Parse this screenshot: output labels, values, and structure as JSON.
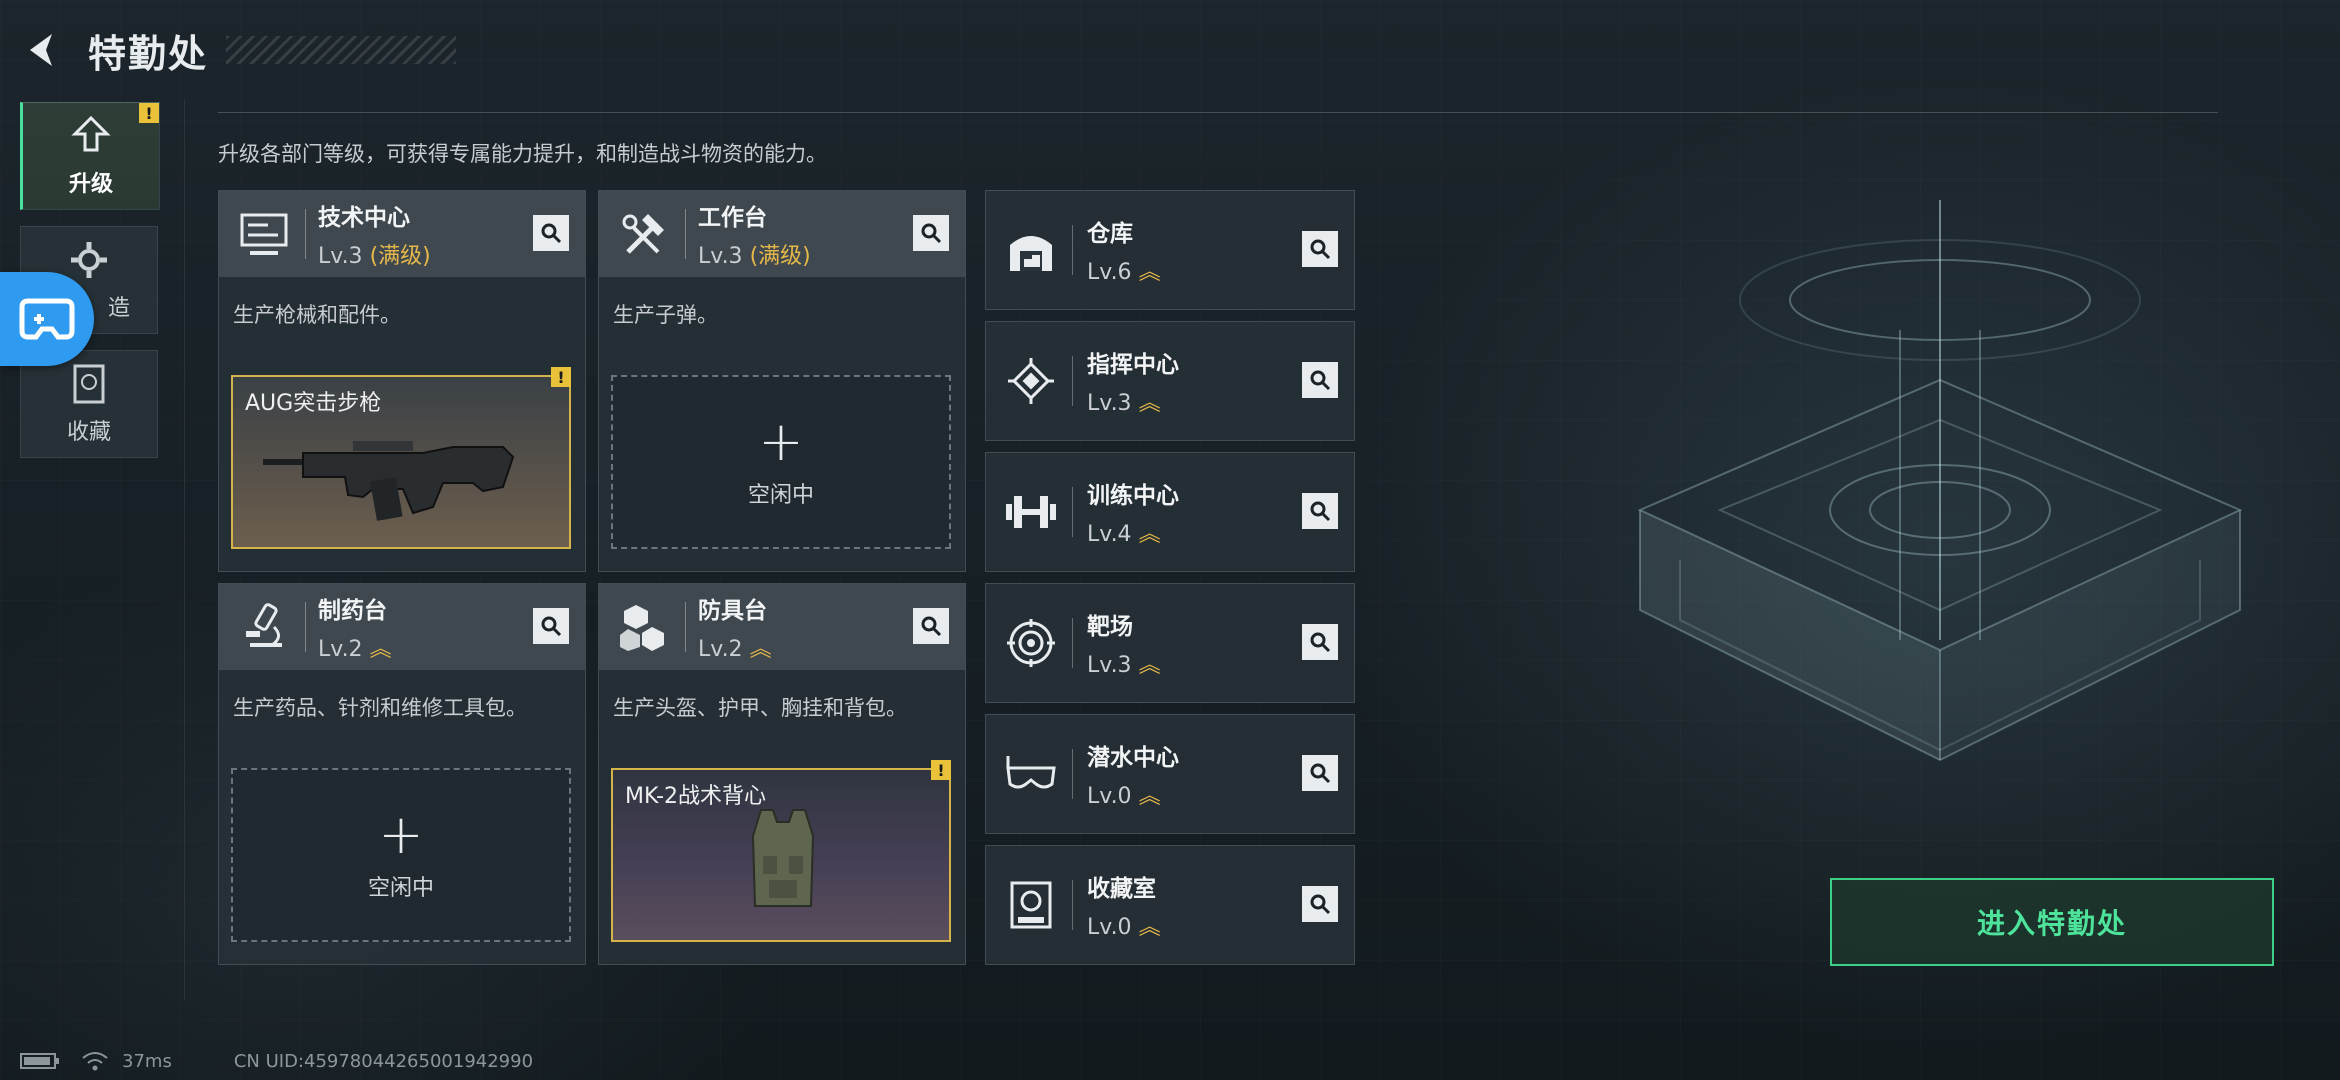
{
  "header": {
    "title": "特勤处"
  },
  "nav": {
    "upgrade": "升级",
    "craft": "造",
    "collection": "收藏"
  },
  "intro": "升级各部门等级，可获得专属能力提升，和制造战斗物资的能力。",
  "cards": [
    {
      "name": "技术中心",
      "level": "Lv.3",
      "max": "(满级)",
      "desc": "生产枪械和配件。",
      "slot_name": "AUG突击步枪"
    },
    {
      "name": "工作台",
      "level": "Lv.3",
      "max": "(满级)",
      "desc": "生产子弹。",
      "slot_idle": "空闲中"
    },
    {
      "name": "制药台",
      "level": "Lv.2",
      "desc": "生产药品、针剂和维修工具包。",
      "slot_idle": "空闲中"
    },
    {
      "name": "防具台",
      "level": "Lv.2",
      "desc": "生产头盔、护甲、胸挂和背包。",
      "slot_name": "MK-2战术背心"
    }
  ],
  "small_cards": [
    {
      "name": "仓库",
      "level": "Lv.6",
      "icon": "warehouse-icon"
    },
    {
      "name": "指挥中心",
      "level": "Lv.3",
      "icon": "command-center-icon"
    },
    {
      "name": "训练中心",
      "level": "Lv.4",
      "icon": "dumbbell-icon"
    },
    {
      "name": "靶场",
      "level": "Lv.3",
      "icon": "target-icon"
    },
    {
      "name": "潜水中心",
      "level": "Lv.0",
      "icon": "diving-mask-icon"
    },
    {
      "name": "收藏室",
      "level": "Lv.0",
      "icon": "collection-room-icon"
    }
  ],
  "enter_button": "进入特勤处",
  "footer": {
    "ping": "37ms",
    "uid": "CN UID:45978044265001942990"
  },
  "colors": {
    "accent": "#4de39a",
    "warning": "#e9c23a",
    "max_level": "#e6b84a",
    "float_button": "#2f9bf0"
  }
}
